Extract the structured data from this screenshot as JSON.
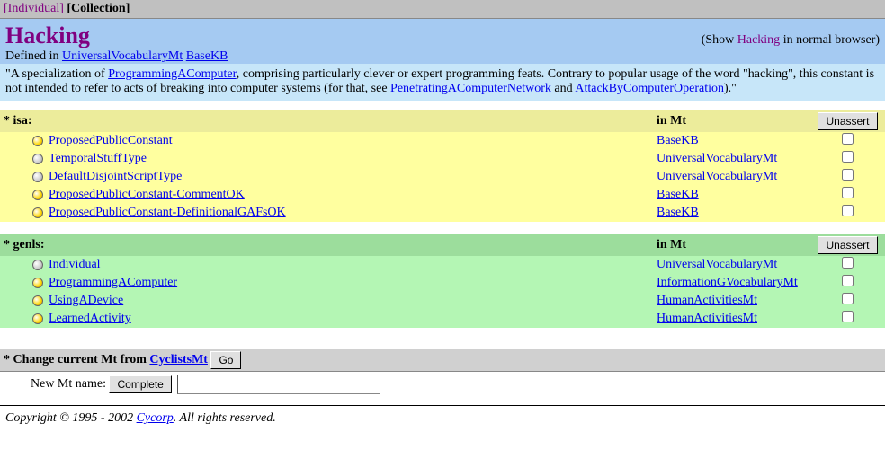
{
  "topbar": {
    "individual": "[Individual]",
    "collection": "[Collection]"
  },
  "header": {
    "title": "Hacking",
    "show_prefix": "(Show ",
    "show_link": "Hacking",
    "show_suffix": " in normal browser)",
    "defined_prefix": "Defined in ",
    "defined_links": [
      "UniversalVocabularyMt",
      "BaseKB"
    ]
  },
  "desc": {
    "t1": "\"A specialization of ",
    "l1": "ProgrammingAComputer",
    "t2": ", comprising particularly clever or expert programming feats. Contrary to popular usage of the word \"hacking\", this constant is not intended to refer to acts of breaking into computer systems (for that, see ",
    "l2": "PenetratingAComputerNetwork",
    "t3": " and ",
    "l3": "AttackByComputerOperation",
    "t4": ").\""
  },
  "isa": {
    "label": "* isa:",
    "mt_label": "in Mt",
    "unassert": "Unassert",
    "rows": [
      {
        "bullet": "yellow",
        "label": "ProposedPublicConstant",
        "mt": "BaseKB"
      },
      {
        "bullet": "gray",
        "label": "TemporalStuffType",
        "mt": "UniversalVocabularyMt"
      },
      {
        "bullet": "gray",
        "label": "DefaultDisjointScriptType",
        "mt": "UniversalVocabularyMt"
      },
      {
        "bullet": "yellow",
        "label": "ProposedPublicConstant-CommentOK",
        "mt": "BaseKB"
      },
      {
        "bullet": "yellow",
        "label": "ProposedPublicConstant-DefinitionalGAFsOK",
        "mt": "BaseKB"
      }
    ]
  },
  "genls": {
    "label": "* genls:",
    "mt_label": "in Mt",
    "unassert": "Unassert",
    "rows": [
      {
        "bullet": "gray",
        "label": "Individual",
        "mt": "UniversalVocabularyMt"
      },
      {
        "bullet": "yellow",
        "label": "ProgrammingAComputer",
        "mt": "InformationGVocabularyMt"
      },
      {
        "bullet": "yellow",
        "label": "UsingADevice",
        "mt": "HumanActivitiesMt"
      },
      {
        "bullet": "yellow",
        "label": "LearnedActivity",
        "mt": "HumanActivitiesMt"
      }
    ]
  },
  "change_mt": {
    "prefix": "* Change current Mt from ",
    "link": "CyclistsMt",
    "go": "Go",
    "new_label": "New Mt name:",
    "complete": "Complete"
  },
  "footer": {
    "t1": "Copyright © 1995 - 2002 ",
    "link": "Cycorp",
    "t2": ". All rights reserved."
  }
}
